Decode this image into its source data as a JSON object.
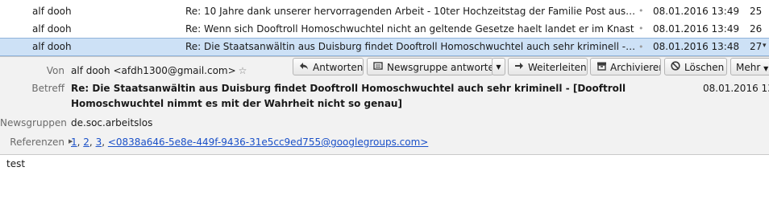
{
  "messages": [
    {
      "from": "alf dooh",
      "subject": "Re: 10 Jahre dank unserer hervorragenden Arbeit - 10ter Hochzeitstag der Familie Post aus Frankfurt Nie...",
      "dot": "•",
      "date": "08.01.2016 13:49",
      "size": "25",
      "selected": false
    },
    {
      "from": "alf dooh",
      "subject": "Re: Wenn sich Dooftroll Homoschwuchtel nicht an geltende Gesetze haelt landet er im Knast",
      "dot": "•",
      "date": "08.01.2016 13:49",
      "size": "26",
      "selected": false
    },
    {
      "from": "alf dooh",
      "subject": "Re: Die Staatsanwältin aus Duisburg findet Dooftroll Homoschwuchtel auch sehr kriminell - [Dooftroll H...",
      "dot": "•",
      "date": "08.01.2016 13:48",
      "size": "27",
      "selected": true
    }
  ],
  "header": {
    "from_label": "Von",
    "from_value": "alf dooh <afdh1300@gmail.com>",
    "star": "☆",
    "subject_label": "Betreff",
    "subject_value": "Re: Die Staatsanwältin aus Duisburg findet Dooftroll Homoschwuchtel auch sehr kriminell - [Dooftroll Homoschwuchtel nimmt es mit der Wahrheit nicht so genau]",
    "date_value": "08.01.2016 13:48",
    "newsgroups_label": "Newsgruppen",
    "newsgroups_value": "de.soc.arbeitslos",
    "references_label": "Referenzen",
    "references": [
      "1",
      "2",
      "3",
      "<0838a646-5e8e-449f-9436-31e5cc9ed755@googlegroups.com>"
    ]
  },
  "toolbar": {
    "reply": "Antworten",
    "reply_newsgroup": "Newsgruppe antworten",
    "forward": "Weiterleiten",
    "archive": "Archivieren",
    "delete": "Löschen",
    "more": "Mehr"
  },
  "icons": {
    "reply": "reply-arrow-icon",
    "reply_newsgroup": "newsgroup-icon",
    "forward": "forward-arrow-icon",
    "archive": "archive-box-icon",
    "delete": "delete-circle-icon"
  },
  "body_text": "test",
  "colors": {
    "selection": "#cde1f6",
    "link": "#1a50c8",
    "header_bg": "#f2f2f2"
  }
}
